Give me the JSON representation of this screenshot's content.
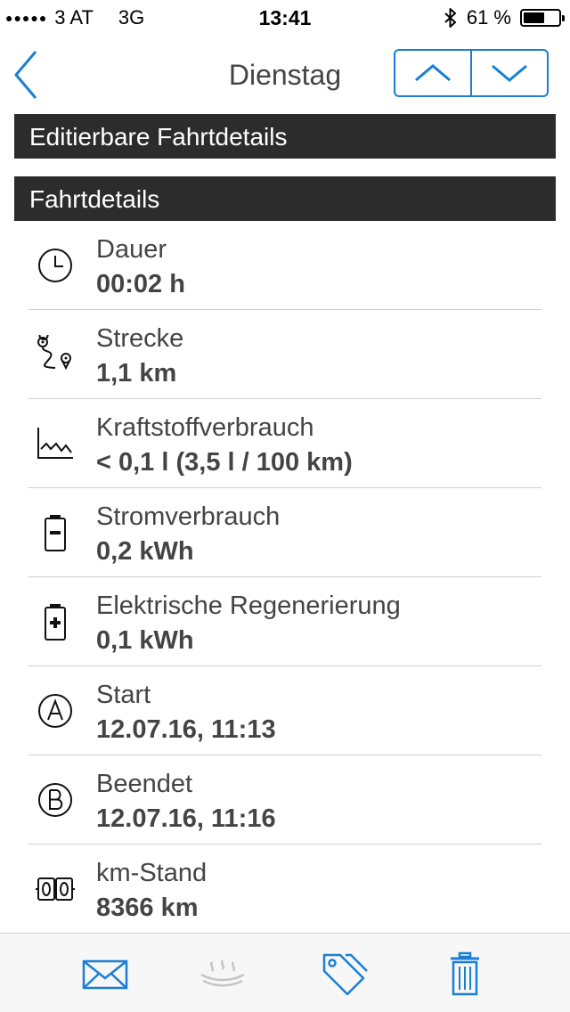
{
  "status_bar": {
    "signal_dots": "●●●●●",
    "carrier": "3 AT",
    "network": "3G",
    "time": "13:41",
    "battery_text": "61 %",
    "battery_level": 0.61
  },
  "nav": {
    "title": "Dienstag",
    "back_icon": "chevron-left-icon",
    "up_icon": "chevron-up-icon",
    "down_icon": "chevron-down-icon"
  },
  "sections": {
    "editable": "Editierbare Fahrtdetails",
    "details": "Fahrtdetails"
  },
  "rows": [
    {
      "icon": "clock-icon",
      "label": "Dauer",
      "value": "00:02 h"
    },
    {
      "icon": "route-icon",
      "label": "Strecke",
      "value": "1,1 km"
    },
    {
      "icon": "consumption-chart-icon",
      "label": "Kraftstoffverbrauch",
      "value": "< 0,1 l (3,5 l / 100 km)"
    },
    {
      "icon": "battery-minus-icon",
      "label": "Stromverbrauch",
      "value": "0,2 kWh"
    },
    {
      "icon": "battery-plus-icon",
      "label": "Elektrische Regenerierung",
      "value": "0,1 kWh"
    },
    {
      "icon": "start-a-icon",
      "label": "Start",
      "value": "12.07.16, 11:13"
    },
    {
      "icon": "end-b-icon",
      "label": "Beendet",
      "value": "12.07.16, 11:16"
    },
    {
      "icon": "odometer-icon",
      "label": "km-Stand",
      "value": "8366 km"
    }
  ],
  "toolbar": {
    "items": [
      "mail-icon",
      "wind-icon",
      "tag-icon",
      "trash-icon"
    ]
  },
  "colors": {
    "accent": "#1a7fd4",
    "header_bg": "#2c2c2c",
    "disabled": "#c4c4c4"
  }
}
